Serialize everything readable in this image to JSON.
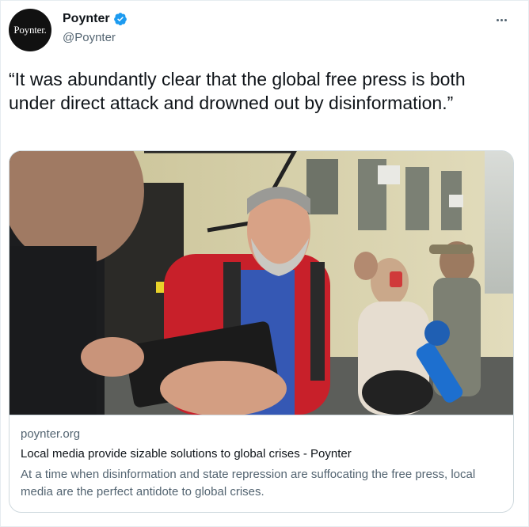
{
  "account": {
    "avatar_text": "Poynter.",
    "display_name": "Poynter",
    "handle": "@Poynter",
    "verified_icon": "verified-badge-icon"
  },
  "tweet": {
    "text": "“It was abundantly clear that the global free press is both under direct attack and drowned out by disinformation.”"
  },
  "link_card": {
    "domain": "poynter.org",
    "title": "Local media provide sizable solutions to global crises - Poynter",
    "description": "At a time when disinformation and state repression are suffocating the free press, local media are the perfect antidote to global crises."
  },
  "icons": {
    "more": "more-icon"
  },
  "colors": {
    "accent": "#1d9bf0",
    "text_primary": "#0f1419",
    "text_secondary": "#536471",
    "border": "#cfd9de"
  }
}
